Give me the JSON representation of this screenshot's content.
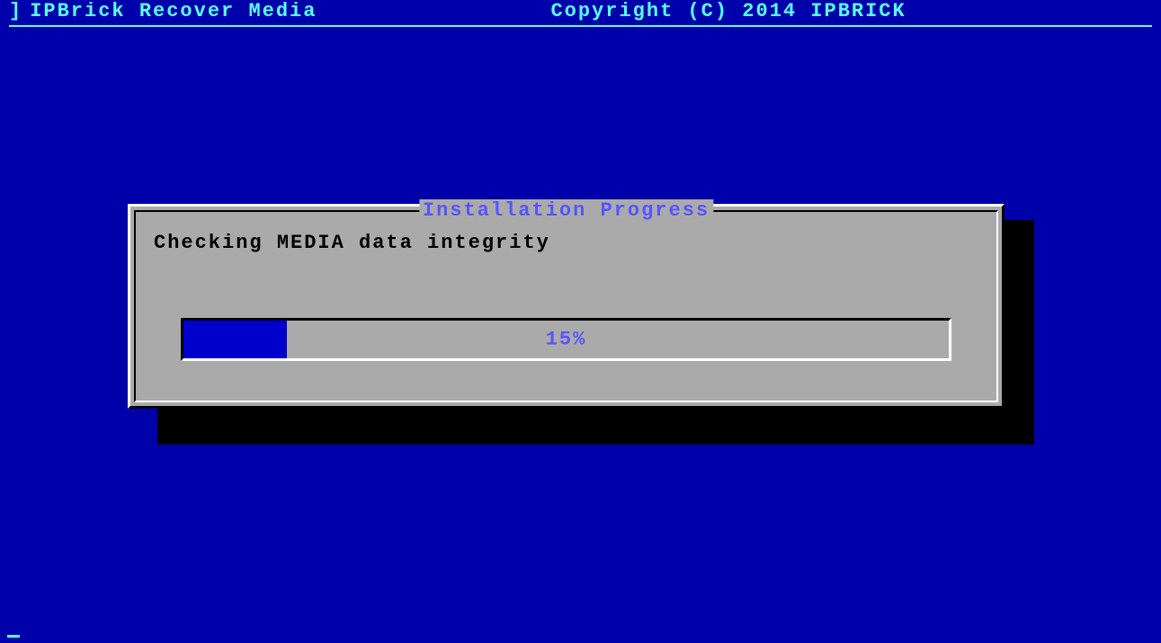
{
  "header": {
    "title": "IPBrick Recover Media",
    "copyright": "Copyright (C) 2014 IPBRICK"
  },
  "dialog": {
    "title": "Installation Progress",
    "status": "Checking MEDIA data integrity",
    "progress_percent": 15,
    "progress_label": "15%"
  }
}
